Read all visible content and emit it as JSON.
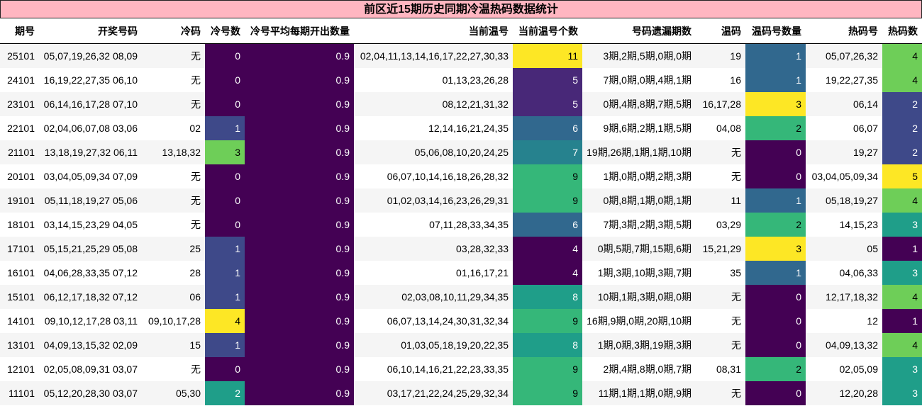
{
  "title": "前区近15期历史同期冷温热码数据统计",
  "columns": [
    "期号",
    "开奖号码",
    "冷码",
    "冷号数",
    "冷号平均每期开出数量",
    "当前温号",
    "当前温号个数",
    "号码遗漏期数",
    "温码",
    "温码号数量",
    "热码号",
    "热码数"
  ],
  "rows": [
    [
      "25101",
      "05,07,19,26,32 08,09",
      "无",
      "0",
      "0.9",
      "02,04,11,13,14,16,17,22,27,30,33",
      "11",
      "3期,2期,5期,0期,0期",
      "19",
      "1",
      "05,07,26,32",
      "4"
    ],
    [
      "24101",
      "16,19,22,27,35 06,10",
      "无",
      "0",
      "0.9",
      "01,13,23,26,28",
      "5",
      "7期,0期,0期,4期,1期",
      "16",
      "1",
      "19,22,27,35",
      "4"
    ],
    [
      "23101",
      "06,14,16,17,28 07,10",
      "无",
      "0",
      "0.9",
      "08,12,21,31,32",
      "5",
      "0期,4期,8期,7期,5期",
      "16,17,28",
      "3",
      "06,14",
      "2"
    ],
    [
      "22101",
      "02,04,06,07,08 03,06",
      "02",
      "1",
      "0.9",
      "12,14,16,21,24,35",
      "6",
      "9期,6期,2期,1期,5期",
      "04,08",
      "2",
      "06,07",
      "2"
    ],
    [
      "21101",
      "13,18,19,27,32 06,11",
      "13,18,32",
      "3",
      "0.9",
      "05,06,08,10,20,24,25",
      "7",
      "19期,26期,1期,1期,10期",
      "无",
      "0",
      "19,27",
      "2"
    ],
    [
      "20101",
      "03,04,05,09,34 07,09",
      "无",
      "0",
      "0.9",
      "06,07,10,14,16,18,26,28,32",
      "9",
      "1期,0期,0期,2期,3期",
      "无",
      "0",
      "03,04,05,09,34",
      "5"
    ],
    [
      "19101",
      "05,11,18,19,27 05,06",
      "无",
      "0",
      "0.9",
      "01,02,03,14,16,23,26,29,31",
      "9",
      "0期,8期,1期,0期,1期",
      "11",
      "1",
      "05,18,19,27",
      "4"
    ],
    [
      "18101",
      "03,14,15,23,29 04,05",
      "无",
      "0",
      "0.9",
      "07,11,28,33,34,35",
      "6",
      "7期,3期,2期,3期,5期",
      "03,29",
      "2",
      "14,15,23",
      "3"
    ],
    [
      "17101",
      "05,15,21,25,29 05,08",
      "25",
      "1",
      "0.9",
      "03,28,32,33",
      "4",
      "0期,5期,7期,15期,6期",
      "15,21,29",
      "3",
      "05",
      "1"
    ],
    [
      "16101",
      "04,06,28,33,35 07,12",
      "28",
      "1",
      "0.9",
      "01,16,17,21",
      "4",
      "1期,3期,10期,3期,7期",
      "35",
      "1",
      "04,06,33",
      "3"
    ],
    [
      "15101",
      "06,12,17,18,32 07,12",
      "06",
      "1",
      "0.9",
      "02,03,08,10,11,29,34,35",
      "8",
      "10期,1期,3期,0期,0期",
      "无",
      "0",
      "12,17,18,32",
      "4"
    ],
    [
      "14101",
      "09,10,12,17,28 03,11",
      "09,10,17,28",
      "4",
      "0.9",
      "06,07,13,14,24,30,31,32,34",
      "9",
      "16期,9期,0期,20期,10期",
      "无",
      "0",
      "12",
      "1"
    ],
    [
      "13101",
      "04,09,13,15,32 02,09",
      "15",
      "1",
      "0.9",
      "01,03,05,18,19,20,22,35",
      "8",
      "1期,0期,3期,19期,3期",
      "无",
      "0",
      "04,09,13,32",
      "4"
    ],
    [
      "12101",
      "02,05,08,09,31 03,07",
      "无",
      "0",
      "0.9",
      "06,10,14,16,21,22,23,33,35",
      "9",
      "2期,4期,8期,0期,7期",
      "08,31",
      "2",
      "02,05,09",
      "3"
    ],
    [
      "11101",
      "05,12,20,28,30 03,07",
      "05,30",
      "2",
      "0.9",
      "03,17,21,22,24,25,29,32,34",
      "9",
      "11期,1期,1期,0期,9期",
      "无",
      "0",
      "12,20,28",
      "3"
    ]
  ],
  "heatmap_columns": [
    3,
    4,
    6,
    9,
    11
  ],
  "colors": {
    "title_bg": "#ffb6c1",
    "viridis": [
      "#440154",
      "#482878",
      "#3e4989",
      "#31688e",
      "#26828e",
      "#1f9e89",
      "#35b779",
      "#6ece58",
      "#b5de2b",
      "#fde725"
    ]
  }
}
